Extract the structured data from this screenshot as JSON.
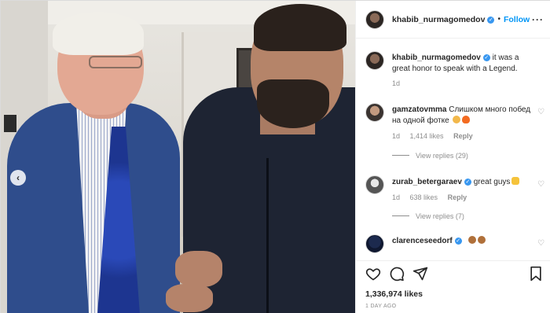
{
  "post": {
    "username": "khabib_nurmagomedov",
    "follow_label": "Follow",
    "dot": "•",
    "more": "···"
  },
  "comments": [
    {
      "username": "khabib_nurmagomedov",
      "text": "it was a great honor to speak with a Legend.",
      "time": "1d",
      "verified": true
    },
    {
      "username": "gamzatovmma",
      "text": "Слишком много побед на одной фотке",
      "time": "1d",
      "likes": "1,414 likes",
      "reply": "Reply",
      "view_replies": "View replies (29)",
      "emoji": [
        "flexed-biceps",
        "fire"
      ]
    },
    {
      "username": "zurab_betergaraev",
      "text": "great guys",
      "time": "1d",
      "likes": "638 likes",
      "reply": "Reply",
      "view_replies": "View replies (7)",
      "verified": true,
      "emoji": [
        "thumbs-up"
      ]
    },
    {
      "username": "clarenceseedorf",
      "text": "",
      "verified": true,
      "emoji": [
        "fist",
        "fist"
      ]
    }
  ],
  "actions": {
    "icons": [
      "heart-icon",
      "comment-icon",
      "share-icon",
      "bookmark-icon"
    ]
  },
  "likes_count": "1,336,974 likes",
  "posted_ago": "1 DAY AGO",
  "colors": {
    "link_blue": "#0095f6",
    "verified_blue": "#3897f0",
    "muted": "#8e8e8e",
    "text": "#262626"
  }
}
